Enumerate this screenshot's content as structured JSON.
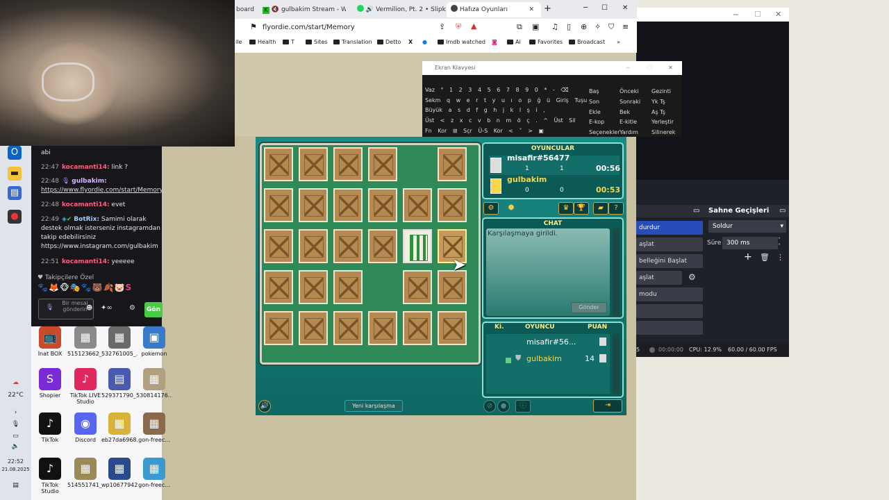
{
  "browser": {
    "tabs": [
      {
        "label": "board"
      },
      {
        "label": "gulbakim Stream - Watch"
      },
      {
        "label": "Vermilion, Pt. 2 • Slipknot"
      },
      {
        "label": "Hafıza Oyunları"
      }
    ],
    "new_tab_label": "+",
    "url": "flyordie.com/start/Memory",
    "bookmarks": [
      "Health",
      "T",
      "Sites",
      "Translation",
      "Detto",
      "X",
      "",
      "Imdb watched",
      "",
      "Ai",
      "Favorites",
      "Broadcast"
    ],
    "bookmarks_prefix": "ile",
    "more_label": "»",
    "window_min": "─",
    "window_max": "☐",
    "window_close": "✕"
  },
  "keyboard": {
    "title": "Ekran Klavyesi",
    "rows": [
      "Vaz ° 1 2 3 4 5 6 7 8 9 0 * - ⌫",
      "Sekm q w e r t y u ı o p ğ ü Giriş Tuşu",
      "Büyük a s d f g h j k l ş i ,",
      "Üst < z x c v b n m ö ç . ^ Üst Sil",
      "Fn Kor ⊞ Sçr Ü-S Kor < ˅ > ▣"
    ],
    "side1": [
      "Baş",
      "Son",
      "Ekle",
      "E-kop",
      "Seçenekler"
    ],
    "side2": [
      "Önceki",
      "Sonraki",
      "Bek",
      "E-kitle",
      "Yardım"
    ],
    "side3": [
      "Gezinti",
      "Yk Tş",
      "Aş Tş",
      "Yerleştir",
      "Silinerek"
    ]
  },
  "chat": {
    "messages": [
      {
        "time": "",
        "user": "",
        "text": "abi",
        "ucls": ""
      },
      {
        "time": "22:47",
        "user": "kocamanti14:",
        "text": "link ?",
        "ucls": "u1"
      },
      {
        "time": "22:48",
        "user": "gulbakim:",
        "text": "https://www.flyordie.com/start/Memory",
        "ucls": "u2"
      },
      {
        "time": "22:48",
        "user": "kocamanti14:",
        "text": "evet",
        "ucls": "u1"
      },
      {
        "time": "22:49",
        "user": "BotRix:",
        "text": "Samimi olarak destek olmak isterseniz instagramdan takip edebilirsiniz https://www.instagram.com/gulbakim",
        "ucls": "u3"
      },
      {
        "time": "22:51",
        "user": "kocamanti14:",
        "text": "yeeeee",
        "ucls": "u1"
      }
    ],
    "followers_label": "♥ Takipçilere Özel",
    "input_placeholder": "Bir mesaj gönderin",
    "send_label": "Gön"
  },
  "desktop": {
    "icons": [
      {
        "label": "İnat BOX",
        "glyph": "📺",
        "color": "#c94a2a"
      },
      {
        "label": "515123662_...",
        "glyph": "▦",
        "color": "#8a8a8a"
      },
      {
        "label": "532761005_...",
        "glyph": "▦",
        "color": "#6a6a6a"
      },
      {
        "label": "pokemon",
        "glyph": "▣",
        "color": "#3a7acb"
      },
      {
        "label": "Shopier",
        "glyph": "S",
        "color": "#7a2ad6"
      },
      {
        "label": "TikTok LIVE Studio",
        "glyph": "♪",
        "color": "#e02860"
      },
      {
        "label": "529371790_...",
        "glyph": "▤",
        "color": "#4a5ab0"
      },
      {
        "label": "530814176...",
        "glyph": "▦",
        "color": "#b0a080"
      },
      {
        "label": "TikTok",
        "glyph": "♪",
        "color": "#111"
      },
      {
        "label": "Discord",
        "glyph": "◉",
        "color": "#5865f2"
      },
      {
        "label": "eb27da6968...",
        "glyph": "▦",
        "color": "#d9b23a"
      },
      {
        "label": "gon-freec...",
        "glyph": "▦",
        "color": "#8a6a4a"
      },
      {
        "label": "TikTok Studio",
        "glyph": "♪",
        "color": "#111"
      },
      {
        "label": "514551741_...",
        "glyph": "▦",
        "color": "#9a8a5a"
      },
      {
        "label": "wp10677942",
        "glyph": "▦",
        "color": "#2a4a8a"
      },
      {
        "label": "gon-freec...",
        "glyph": "▦",
        "color": "#3a9ad0"
      }
    ]
  },
  "taskbar": {
    "weather": "22°C",
    "time": "22:52",
    "date": "21.08.2025"
  },
  "game": {
    "players_title": "OYUNCULAR",
    "players": [
      {
        "name": "misafir#56477",
        "a": "1",
        "b": "1",
        "time": "00:56",
        "color": "#ffffff"
      },
      {
        "name": "gulbakim",
        "a": "0",
        "b": "0",
        "time": "00:53",
        "color": "#f6d64a"
      }
    ],
    "chat_title": "CHAT",
    "chat_text": "Karşılaşmaya girildi.",
    "send_label": "Gönder",
    "score_headers": [
      "Ki.",
      "OYUNCU",
      "PUAN"
    ],
    "scores": [
      {
        "name": "misafir#56...",
        "score": ""
      },
      {
        "name": "gulbakim",
        "score": "14"
      }
    ],
    "new_game_label": "Yeni karşılaşma",
    "board": {
      "rows": [
        [
          "c",
          "c",
          "c",
          "c",
          "e",
          "c"
        ],
        [
          "c",
          "c",
          "c",
          "c",
          "c",
          "c"
        ],
        [
          "c",
          "c",
          "c",
          "c",
          "f",
          "h"
        ],
        [
          "c",
          "c",
          "c",
          "e",
          "c",
          "c"
        ],
        [
          "c",
          "c",
          "c",
          "c",
          "c",
          "c"
        ]
      ]
    }
  },
  "obs": {
    "transitions_title": "Sahne Geçişleri",
    "scenes": [
      "durdur",
      "aşlat",
      "belleğini Başlat",
      "aşlat",
      "modu"
    ],
    "transition": "Soldur",
    "duration_label": "Süre",
    "duration": "300 ms",
    "stream_time": "00:00:00",
    "cpu": "CPU: 12.9%",
    "fps": "60.00 / 60.00 FPS"
  }
}
